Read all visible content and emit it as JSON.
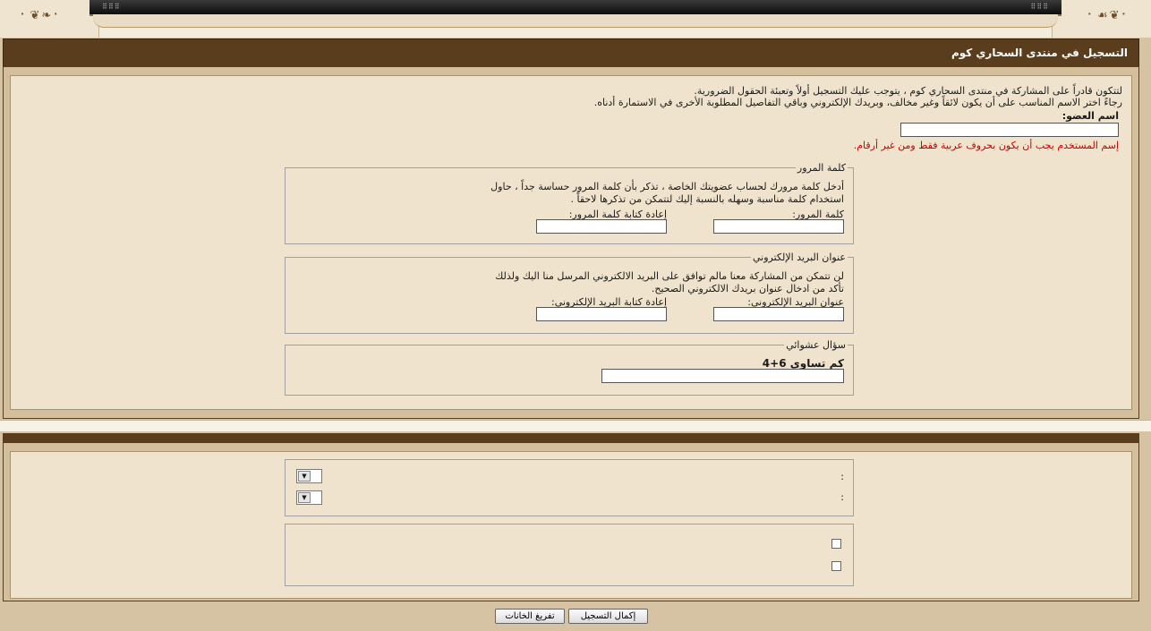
{
  "header": {
    "title": "التسجيل في منتدى السحاري كوم"
  },
  "intro": {
    "line1": "لتتكون قادراً على المشاركة في منتدى السحاري كوم ، يتوجب عليك التسجيل أولاً وتعبئة الحقول الضرورية.",
    "line2": "رجاءً اختر الاسم المناسب على أن يكون لائقاً وغير مخالف، وبريدك الإلكتروني وباقي التفاصيل المطلوبة الأخرى في الاستمارة أدناه."
  },
  "username": {
    "label": "اسم العضو:",
    "value": "",
    "warning": "إسم المستخدم يجب أن يكون بحروف عربية فقط ومن غير أرقام."
  },
  "password": {
    "legend": "كلمة المرور",
    "desc1": "أدخل كلمة مرورك لحساب عضويتك الخاصة ، تذكر بأن كلمة المرور حساسة جداً ، حاول",
    "desc2": "استخدام كلمة مناسبة وسهله بالنسبة إليك لتتمكن من تذكرها لاحقاً .",
    "label": "كلمة المرور:",
    "confirm_label": "إعادة كتابة كلمة المرور:",
    "value": "",
    "confirm_value": ""
  },
  "email": {
    "legend": "عنوان البريد الإلكتروني",
    "desc1": "لن تتمكن من المشاركة معنا مالم توافق على البريد الالكتروني المرسل منا اليك ولذلك",
    "desc2": "تأكد من ادخال عنوان بريدك الالكتروني الصحيح.",
    "label": "عنوان البريد الإلكتروني:",
    "confirm_label": "إعادة كتابة البريد الإلكتروني:",
    "value": "",
    "confirm_value": ""
  },
  "captcha": {
    "legend": "سؤال عشوائي",
    "question": "كم تساوي 6+4",
    "value": ""
  },
  "options": {
    "select1_label": ":",
    "select2_label": ":"
  },
  "buttons": {
    "submit": "إكمال التسجيل",
    "reset": "تفريغ الخانات"
  }
}
